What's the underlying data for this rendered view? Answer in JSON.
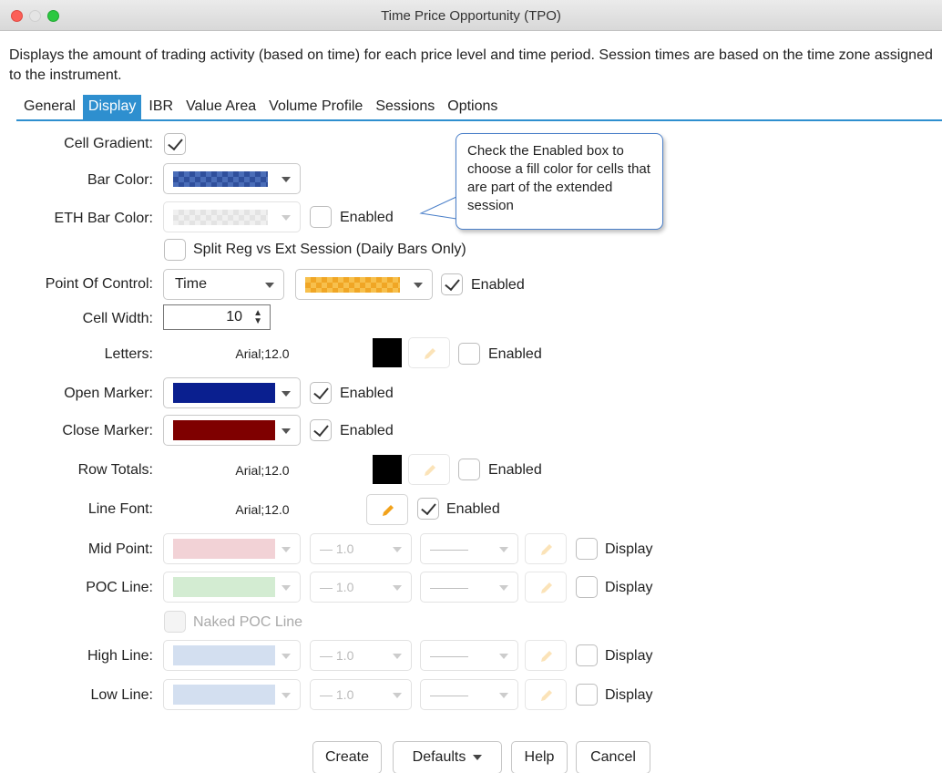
{
  "window": {
    "title": "Time Price Opportunity (TPO)"
  },
  "description": "Displays the amount of trading activity (based on time) for each price level and time period. Session times are based on the time zone assigned to the instrument.",
  "tabs": [
    {
      "label": "General"
    },
    {
      "label": "Display"
    },
    {
      "label": "IBR"
    },
    {
      "label": "Value Area"
    },
    {
      "label": "Volume Profile"
    },
    {
      "label": "Sessions"
    },
    {
      "label": "Options"
    }
  ],
  "active_tab": "Display",
  "tooltip": "Check the Enabled box to choose a fill color for cells that are part of the extended session",
  "fields": {
    "cell_gradient": {
      "label": "Cell Gradient:",
      "checked": true
    },
    "bar_color": {
      "label": "Bar Color:"
    },
    "eth_bar_color": {
      "label": "ETH Bar Color:",
      "enabled_label": "Enabled"
    },
    "split": {
      "label": "Split Reg vs Ext Session (Daily Bars Only)"
    },
    "poc": {
      "label": "Point Of Control:",
      "mode": "Time",
      "enabled_label": "Enabled"
    },
    "cell_width": {
      "label": "Cell Width:",
      "value": "10"
    },
    "letters": {
      "label": "Letters:",
      "font": "Arial;12.0",
      "enabled_label": "Enabled"
    },
    "open_marker": {
      "label": "Open Marker:",
      "color": "#0a1f8f",
      "enabled_label": "Enabled"
    },
    "close_marker": {
      "label": "Close Marker:",
      "color": "#7f0000",
      "enabled_label": "Enabled"
    },
    "row_totals": {
      "label": "Row Totals:",
      "font": "Arial;12.0",
      "enabled_label": "Enabled"
    },
    "line_font": {
      "label": "Line Font:",
      "font": "Arial;12.0",
      "enabled_label": "Enabled"
    },
    "mid_point": {
      "label": "Mid Point:",
      "color": "#f2d2d6",
      "width": "1.0",
      "display_label": "Display"
    },
    "poc_line": {
      "label": "POC Line:",
      "color": "#d3ecd2",
      "width": "1.0",
      "display_label": "Display"
    },
    "naked_poc": {
      "label": "Naked POC Line"
    },
    "high_line": {
      "label": "High Line:",
      "color": "#d3dff0",
      "width": "1.0",
      "display_label": "Display"
    },
    "low_line": {
      "label": "Low Line:",
      "color": "#d3dff0",
      "width": "1.0",
      "display_label": "Display"
    }
  },
  "buttons": {
    "create": "Create",
    "defaults": "Defaults",
    "help": "Help",
    "cancel": "Cancel"
  },
  "colors": {
    "accent": "#2e8fcf",
    "pencil": "#f2a21b"
  }
}
